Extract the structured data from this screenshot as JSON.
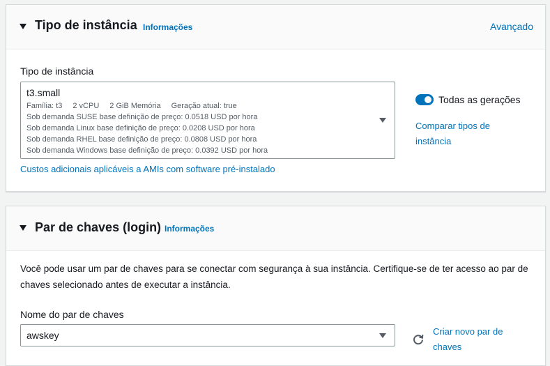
{
  "instance_panel": {
    "title": "Tipo de instância",
    "info": "Informações",
    "advanced": "Avançado",
    "field_label": "Tipo de instância",
    "selected": "t3.small",
    "family": "Família: t3",
    "vcpu": "2 vCPU",
    "memory": "2 GiB Memória",
    "generation": "Geração atual: true",
    "prices": [
      "Sob demanda SUSE base definição de preço: 0.0518 USD por hora",
      "Sob demanda Linux base definição de preço: 0.0208 USD por hora",
      "Sob demanda RHEL base definição de preço: 0.0808 USD por hora",
      "Sob demanda Windows base definição de preço: 0.0392 USD por hora"
    ],
    "ami_costs_link": "Custos adicionais aplicáveis a AMIs com software pré-instalado",
    "toggle_label": "Todas as gerações",
    "toggle_on": true,
    "compare_link": "Comparar tipos de instância"
  },
  "keypair_panel": {
    "title": "Par de chaves (login)",
    "info": "Informações",
    "description": "Você pode usar um par de chaves para se conectar com segurança à sua instância. Certifique-se de ter acesso ao par de chaves selecionado antes de executar a instância.",
    "field_label": "Nome do par de chaves",
    "selected": "awskey",
    "refresh_icon": "refresh-icon",
    "create_link": "Criar novo par de chaves"
  }
}
